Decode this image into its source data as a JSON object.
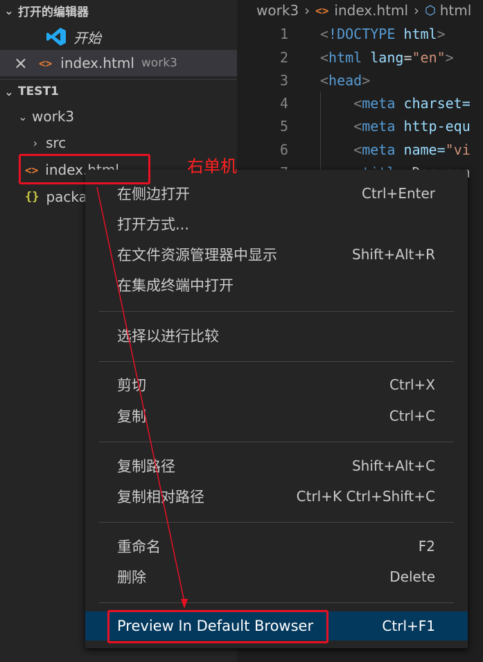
{
  "sidebar": {
    "open_editors": {
      "title": "打开的编辑器",
      "items": [
        {
          "label": "开始",
          "icon": "vscode-logo-icon"
        },
        {
          "label": "index.html",
          "description": "work3",
          "icon": "html-file-icon",
          "close": "×"
        }
      ]
    },
    "explorer": {
      "title": "TEST1",
      "items": [
        {
          "label": "work3",
          "kind": "folder-expanded"
        },
        {
          "label": "src",
          "kind": "folder-collapsed"
        },
        {
          "label": "index.html",
          "kind": "html-file"
        },
        {
          "label": "package.json",
          "kind": "json-file"
        }
      ]
    }
  },
  "editor": {
    "breadcrumb": [
      "work3",
      "index.html",
      "html"
    ],
    "lines": [
      {
        "n": "1"
      },
      {
        "n": "2"
      },
      {
        "n": "3"
      },
      {
        "n": "4"
      },
      {
        "n": "5"
      },
      {
        "n": "6"
      },
      {
        "n": "7"
      }
    ],
    "code": {
      "l1_doctype": "!DOCTYPE",
      "l1_html": "html",
      "l2_tag": "html",
      "l2_attr": "lang",
      "l2_val": "\"en\"",
      "l3_tag": "head",
      "meta": "meta",
      "l4_attr": "charset=",
      "l5_attr": "http-equ",
      "l6_attr": "name=",
      "l6_val": "\"vi",
      "l7_tag": "title",
      "l7_text": "Documen"
    }
  },
  "annotation": "右单机",
  "context_menu": {
    "groups": [
      [
        {
          "label": "在侧边打开",
          "shortcut": "Ctrl+Enter"
        },
        {
          "label": "打开方式...",
          "shortcut": ""
        },
        {
          "label": "在文件资源管理器中显示",
          "shortcut": "Shift+Alt+R"
        },
        {
          "label": "在集成终端中打开",
          "shortcut": ""
        }
      ],
      [
        {
          "label": "选择以进行比较",
          "shortcut": ""
        }
      ],
      [
        {
          "label": "剪切",
          "shortcut": "Ctrl+X"
        },
        {
          "label": "复制",
          "shortcut": "Ctrl+C"
        }
      ],
      [
        {
          "label": "复制路径",
          "shortcut": "Shift+Alt+C"
        },
        {
          "label": "复制相对路径",
          "shortcut": "Ctrl+K Ctrl+Shift+C"
        }
      ],
      [
        {
          "label": "重命名",
          "shortcut": "F2"
        },
        {
          "label": "删除",
          "shortcut": "Delete"
        }
      ],
      [
        {
          "label": "Preview In Default Browser",
          "shortcut": "Ctrl+F1",
          "highlighted": true
        }
      ]
    ]
  },
  "colors": {
    "sidebar_bg": "#252526",
    "editor_bg": "#1e1e1e",
    "menu_highlight": "#04395e",
    "annotation_red": "#e81123",
    "html_icon": "#e37933",
    "json_icon": "#cbcb41",
    "vscode_blue": "#23a9f2"
  }
}
